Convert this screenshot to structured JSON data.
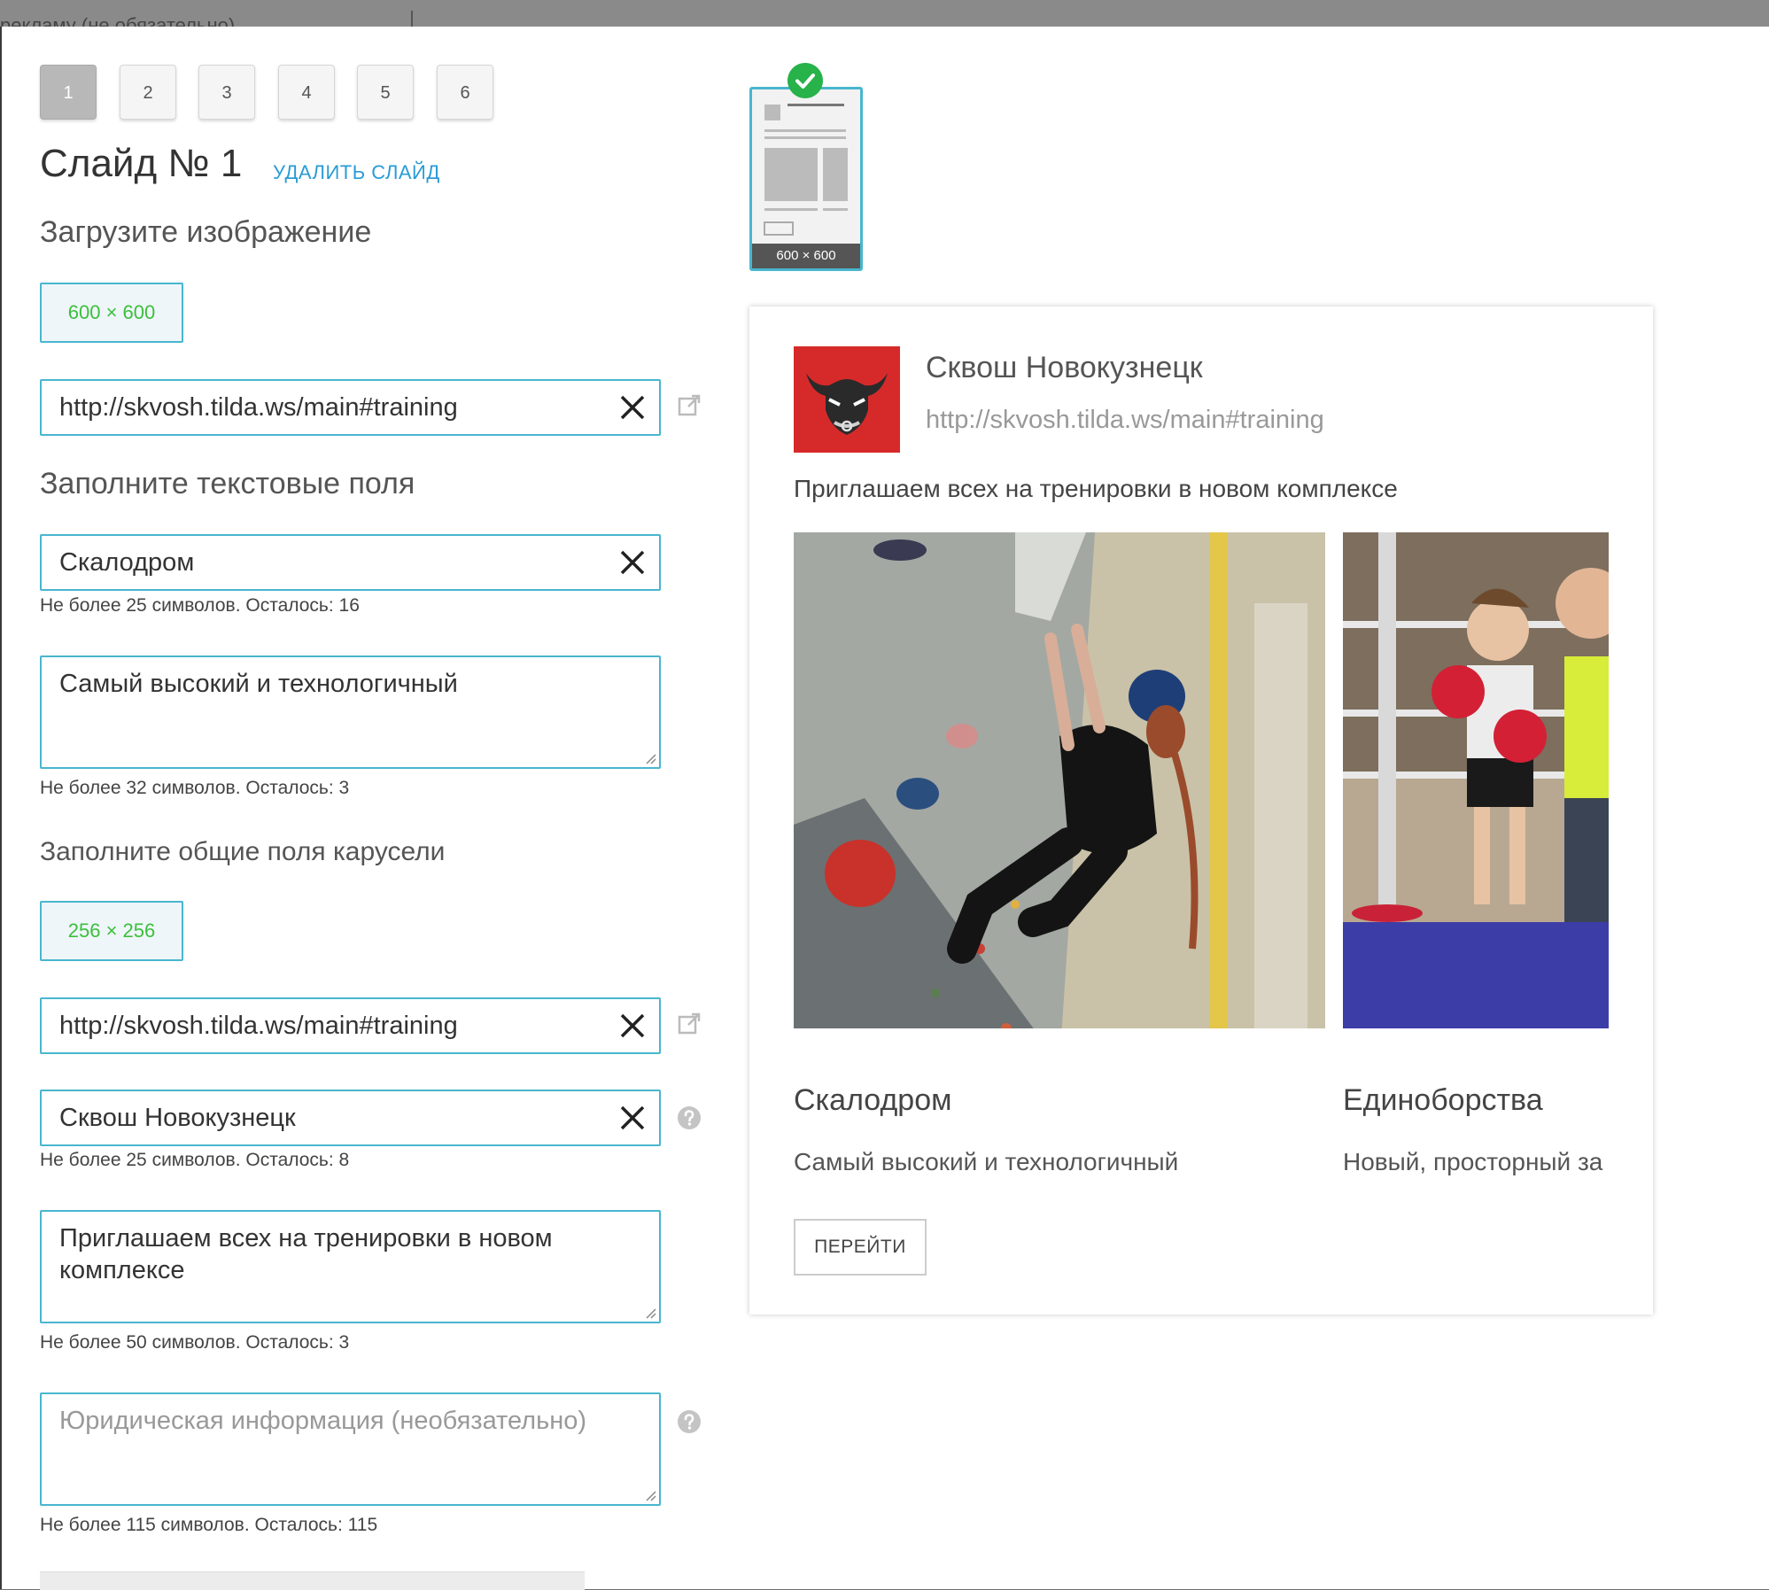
{
  "background_title": "рекламу (не обязательно)",
  "tabs": [
    {
      "label": "1",
      "active": true
    },
    {
      "label": "2",
      "active": false
    },
    {
      "label": "3",
      "active": false
    },
    {
      "label": "4",
      "active": false
    },
    {
      "label": "5",
      "active": false
    },
    {
      "label": "6",
      "active": false
    }
  ],
  "slide_heading": "Слайд № 1",
  "delete_slide": "УДАЛИТЬ СЛАЙД",
  "upload_label": "Загрузите изображение",
  "image_size_button": "600 × 600",
  "slide_link": "http://skvosh.tilda.ws/main#training",
  "text_fields_label": "Заполните текстовые поля",
  "slide_title_value": "Скалодром",
  "slide_title_hint": "Не более 25 символов. Осталось: 16",
  "slide_desc_value": "Самый высокий и технологичный",
  "slide_desc_hint": "Не более 32 символов. Осталось: 3",
  "carousel_fields_label": "Заполните общие поля карусели",
  "logo_size_button": "256 × 256",
  "carousel_link": "http://skvosh.tilda.ws/main#training",
  "carousel_name_value": "Сквош Новокузнецк",
  "carousel_name_hint": "Не более 25 символов. Осталось: 8",
  "carousel_text_value": "Приглашаем всех на тренировки в новом комплексе",
  "carousel_text_hint": "Не более 50 символов. Осталось: 3",
  "legal_placeholder": "Юридическая информация (необязательно)",
  "legal_hint": "Не более 115 символов. Осталось: 115",
  "thumbnail_label": "600 × 600",
  "preview": {
    "name": "Сквош Новокузнецк",
    "url": "http://skvosh.tilda.ws/main#training",
    "text": "Приглашаем всех на тренировки в новом комплексе",
    "slides": [
      {
        "title": "Скалодром",
        "desc": "Самый высокий и технологичный"
      },
      {
        "title": "Единоборства",
        "desc": "Новый, просторный за"
      }
    ],
    "button": "ПЕРЕЙТИ"
  },
  "colors": {
    "accent": "#49b6cf",
    "link": "#2b9bd6",
    "size_text": "#3cbf3c",
    "check": "#28b24a",
    "logo_bg": "#d62a2a"
  }
}
